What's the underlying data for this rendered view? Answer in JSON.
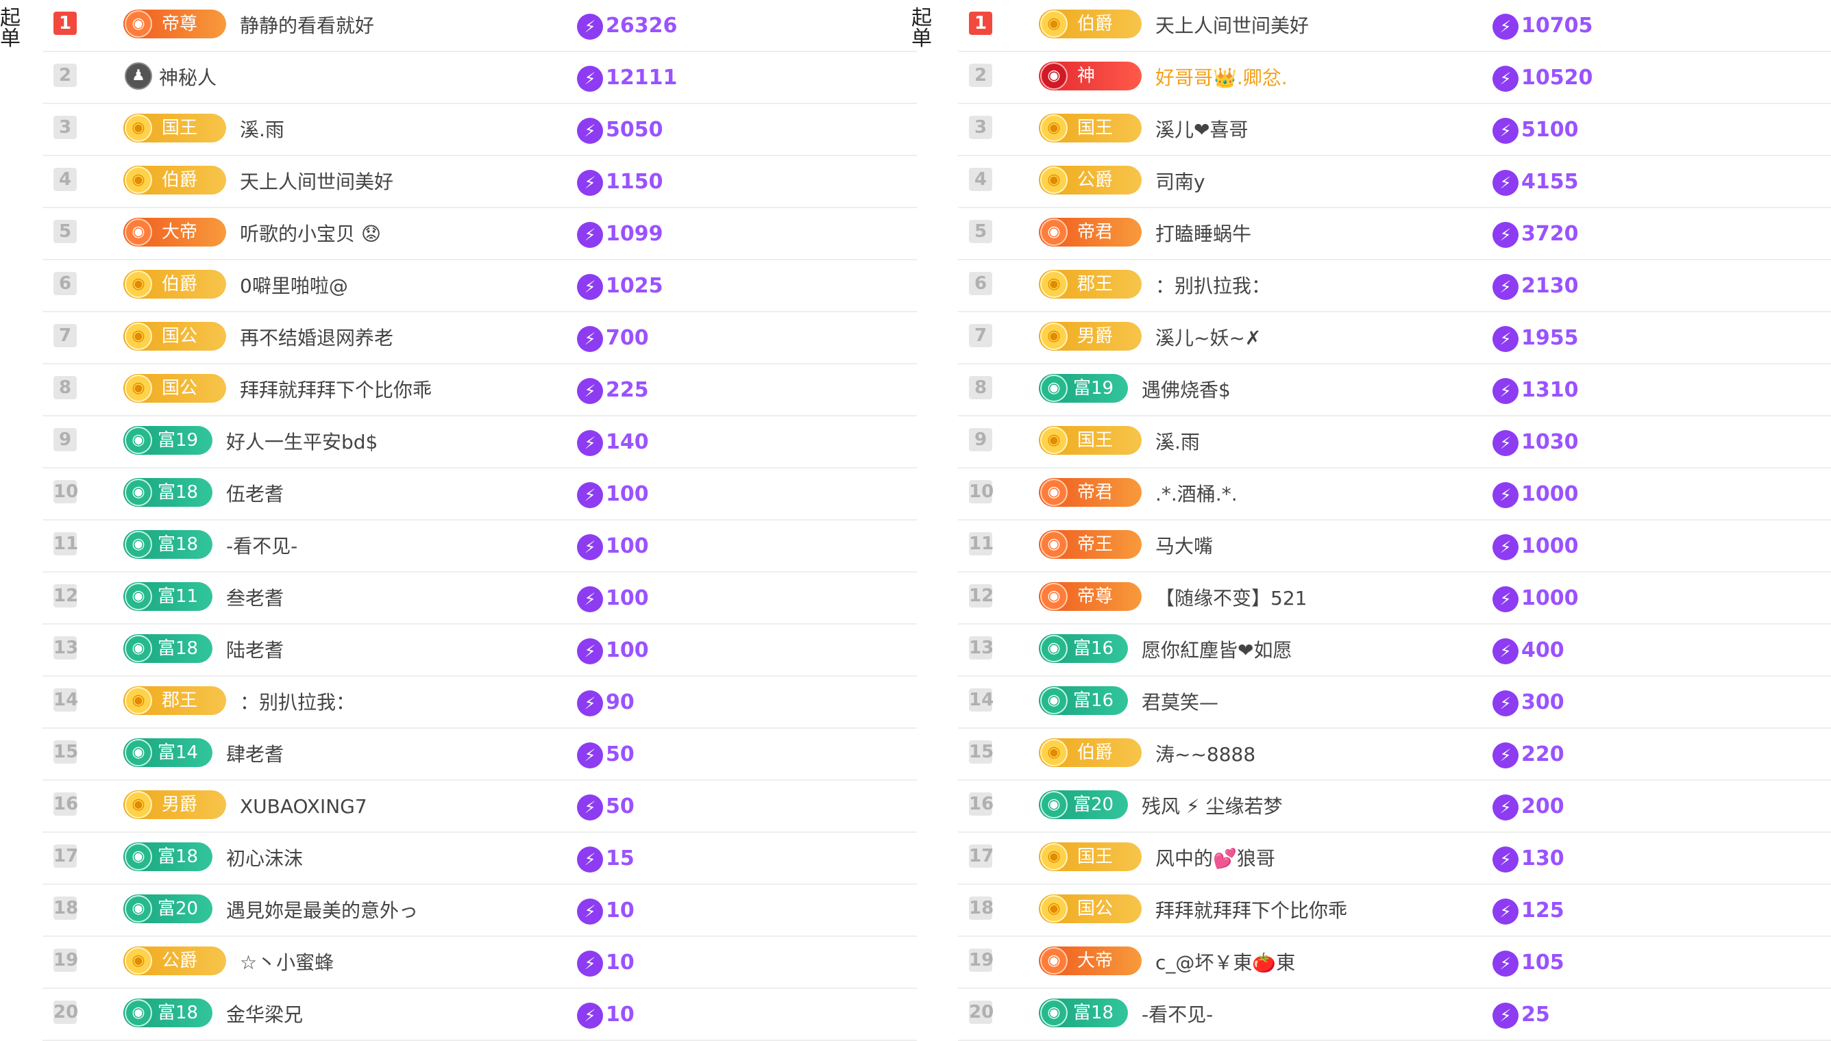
{
  "edge": {
    "left": "起\n单",
    "mid": "起\n单"
  },
  "icons": {
    "bolt": "⚡",
    "medal": "◉",
    "mystery": "♟"
  },
  "left": [
    {
      "rank": "1",
      "badge": "帝尊",
      "style": "orange",
      "name": "静静的看看就好",
      "score": "26326"
    },
    {
      "rank": "2",
      "badge": "",
      "style": "none",
      "name": "神秘人",
      "score": "12111"
    },
    {
      "rank": "3",
      "badge": "国王",
      "style": "gold",
      "name": "溪.雨",
      "score": "5050"
    },
    {
      "rank": "4",
      "badge": "伯爵",
      "style": "gold",
      "name": "天上人间世间美好",
      "score": "1150"
    },
    {
      "rank": "5",
      "badge": "大帝",
      "style": "orange",
      "name": "听歌的小宝贝 😟",
      "score": "1099"
    },
    {
      "rank": "6",
      "badge": "伯爵",
      "style": "gold",
      "name": "0噼里啪啦@",
      "score": "1025"
    },
    {
      "rank": "7",
      "badge": "国公",
      "style": "gold",
      "name": "再不结婚退网养老",
      "score": "700"
    },
    {
      "rank": "8",
      "badge": "国公",
      "style": "gold",
      "name": "拜拜就拜拜下个比你乖",
      "score": "225"
    },
    {
      "rank": "9",
      "badge": "富19",
      "style": "green",
      "name": "好人一生平安bd$",
      "score": "140"
    },
    {
      "rank": "10",
      "badge": "富18",
      "style": "green",
      "name": "伍老耆",
      "score": "100"
    },
    {
      "rank": "11",
      "badge": "富18",
      "style": "green",
      "name": "-看不见-",
      "score": "100"
    },
    {
      "rank": "12",
      "badge": "富11",
      "style": "green",
      "name": "叁老耆",
      "score": "100"
    },
    {
      "rank": "13",
      "badge": "富18",
      "style": "green",
      "name": "陆老耆",
      "score": "100"
    },
    {
      "rank": "14",
      "badge": "郡王",
      "style": "gold",
      "name": "：别扒拉我：",
      "score": "90"
    },
    {
      "rank": "15",
      "badge": "富14",
      "style": "green",
      "name": "肆老耆",
      "score": "50"
    },
    {
      "rank": "16",
      "badge": "男爵",
      "style": "gold",
      "name": "XUBAOXING7",
      "score": "50"
    },
    {
      "rank": "17",
      "badge": "富18",
      "style": "green",
      "name": "初心沫沫",
      "score": "15"
    },
    {
      "rank": "18",
      "badge": "富20",
      "style": "green",
      "name": "遇見妳是最美的意外っ",
      "score": "10"
    },
    {
      "rank": "19",
      "badge": "公爵",
      "style": "gold",
      "name": "☆丶小蜜蜂",
      "score": "10"
    },
    {
      "rank": "20",
      "badge": "富18",
      "style": "green",
      "name": "金华梁兄",
      "score": "10"
    }
  ],
  "right": [
    {
      "rank": "1",
      "badge": "伯爵",
      "style": "gold",
      "name": "天上人间世间美好",
      "score": "10705"
    },
    {
      "rank": "2",
      "badge": "神",
      "style": "red",
      "name": "好哥哥👑.卿忿.",
      "score": "10520",
      "gold": true
    },
    {
      "rank": "3",
      "badge": "国王",
      "style": "gold",
      "name": "溪儿❤喜哥",
      "score": "5100"
    },
    {
      "rank": "4",
      "badge": "公爵",
      "style": "gold",
      "name": "司南y",
      "score": "4155"
    },
    {
      "rank": "5",
      "badge": "帝君",
      "style": "orange",
      "name": "打瞌睡蜗牛",
      "score": "3720"
    },
    {
      "rank": "6",
      "badge": "郡王",
      "style": "gold",
      "name": "：别扒拉我：",
      "score": "2130"
    },
    {
      "rank": "7",
      "badge": "男爵",
      "style": "gold",
      "name": "溪儿~妖~✗",
      "score": "1955"
    },
    {
      "rank": "8",
      "badge": "富19",
      "style": "green",
      "name": "遇佛烧香$",
      "score": "1310"
    },
    {
      "rank": "9",
      "badge": "国王",
      "style": "gold",
      "name": "溪.雨",
      "score": "1030"
    },
    {
      "rank": "10",
      "badge": "帝君",
      "style": "orange",
      "name": ".*.酒桶.*.",
      "score": "1000"
    },
    {
      "rank": "11",
      "badge": "帝王",
      "style": "orange",
      "name": "马大嘴",
      "score": "1000"
    },
    {
      "rank": "12",
      "badge": "帝尊",
      "style": "orange",
      "name": "【随缘不变】521",
      "score": "1000"
    },
    {
      "rank": "13",
      "badge": "富16",
      "style": "green",
      "name": "愿你紅塵皆❤如愿",
      "score": "400"
    },
    {
      "rank": "14",
      "badge": "富16",
      "style": "green",
      "name": "君莫笑—",
      "score": "300"
    },
    {
      "rank": "15",
      "badge": "伯爵",
      "style": "gold",
      "name": "涛~~8888",
      "score": "220"
    },
    {
      "rank": "16",
      "badge": "富20",
      "style": "green",
      "name": "残风 ⚡ 尘缘若梦",
      "score": "200"
    },
    {
      "rank": "17",
      "badge": "国王",
      "style": "gold",
      "name": "风中的💕狼哥",
      "score": "130"
    },
    {
      "rank": "18",
      "badge": "国公",
      "style": "gold",
      "name": "拜拜就拜拜下个比你乖",
      "score": "125"
    },
    {
      "rank": "19",
      "badge": "大帝",
      "style": "orange",
      "name": "c_@坏￥東🍅東",
      "score": "105"
    },
    {
      "rank": "20",
      "badge": "富18",
      "style": "green",
      "name": "-看不见-",
      "score": "25"
    }
  ]
}
